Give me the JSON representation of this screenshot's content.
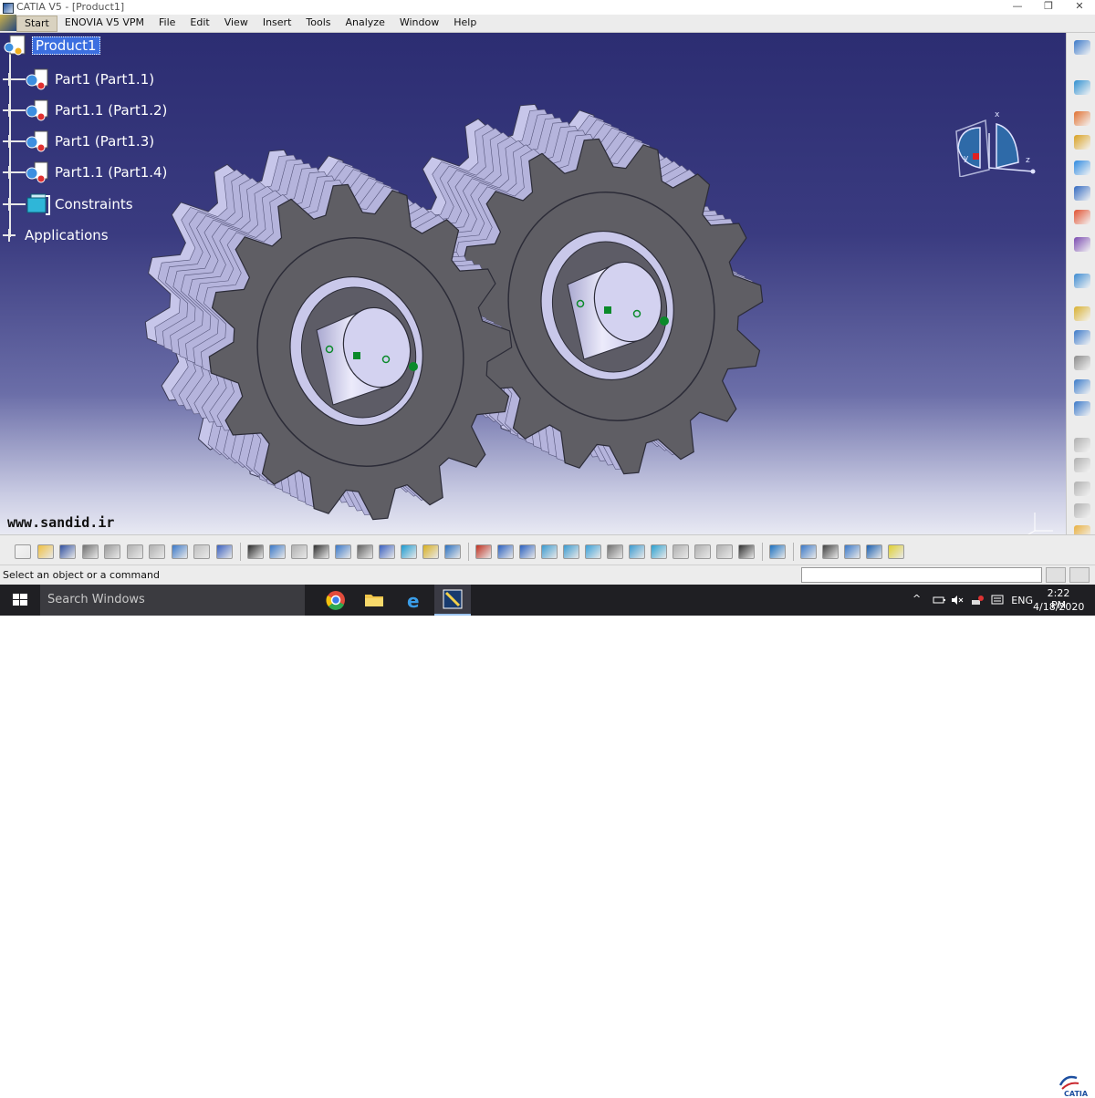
{
  "window": {
    "title": "CATIA V5 - [Product1]",
    "controls": [
      "—",
      "❐",
      "✕"
    ]
  },
  "menubar": {
    "items": [
      "Start",
      "ENOVIA V5 VPM",
      "File",
      "Edit",
      "View",
      "Insert",
      "Tools",
      "Analyze",
      "Window",
      "Help"
    ]
  },
  "tree": {
    "root": "Product1",
    "children": [
      {
        "label": "Part1 (Part1.1)"
      },
      {
        "label": "Part1.1 (Part1.2)"
      },
      {
        "label": "Part1 (Part1.3)"
      },
      {
        "label": "Part1.1 (Part1.4)"
      },
      {
        "label": "Constraints"
      }
    ],
    "applications": "Applications"
  },
  "compass": {
    "axes": [
      "x",
      "y",
      "z"
    ]
  },
  "watermark": "www.sandid.ir",
  "status": {
    "message": "Select an object or a command",
    "command_value": ""
  },
  "logo": "CATIA",
  "taskbar": {
    "search_placeholder": "Search Windows",
    "language": "ENG",
    "time": "2:22 PM",
    "date": "4/18/2020"
  },
  "colors": {
    "viewport_top": "#2c2d72",
    "viewport_bottom": "#e8e9f3",
    "gear_face": "#5f5e64",
    "gear_teeth": "#c7c6ea",
    "selection": "#3c6fe0"
  },
  "icons": {
    "right_toolbar": [
      "sketcher-icon",
      "compass-icon",
      "snap-icon",
      "assembly-icon",
      "fix-icon",
      "manipulate-icon",
      "explode-icon",
      "clash-icon",
      "measure-icon",
      "scene-icon",
      "catalog-icon",
      "render-icon",
      "update-icon",
      "tools-icon",
      "constraint-icon",
      "constraint-icon",
      "constraint-icon",
      "constraint-icon",
      "cursor-icon"
    ],
    "bottom_toolbar": [
      "new-icon",
      "open-icon",
      "save-icon",
      "print-icon",
      "cut-icon",
      "copy-icon",
      "paste-icon",
      "undo-icon",
      "redo-icon",
      "help-icon",
      "formula-icon",
      "knowledge-icon",
      "macro-icon",
      "table-icon",
      "tree-icon",
      "hole-icon",
      "graph-icon",
      "fly-icon",
      "fit-all-icon",
      "pan-icon",
      "rotate-icon",
      "zoom-in-icon",
      "zoom-out-icon",
      "normal-view-icon",
      "views-icon",
      "render-style-icon",
      "hide-show-icon",
      "swap-icon",
      "quick-icon",
      "snapshot-icon",
      "target-icon",
      "rewind-icon",
      "play-icon",
      "magnifier-icon",
      "camera-icon",
      "light-icon",
      "measure-icon",
      "environment-icon",
      "mark-icon"
    ]
  }
}
